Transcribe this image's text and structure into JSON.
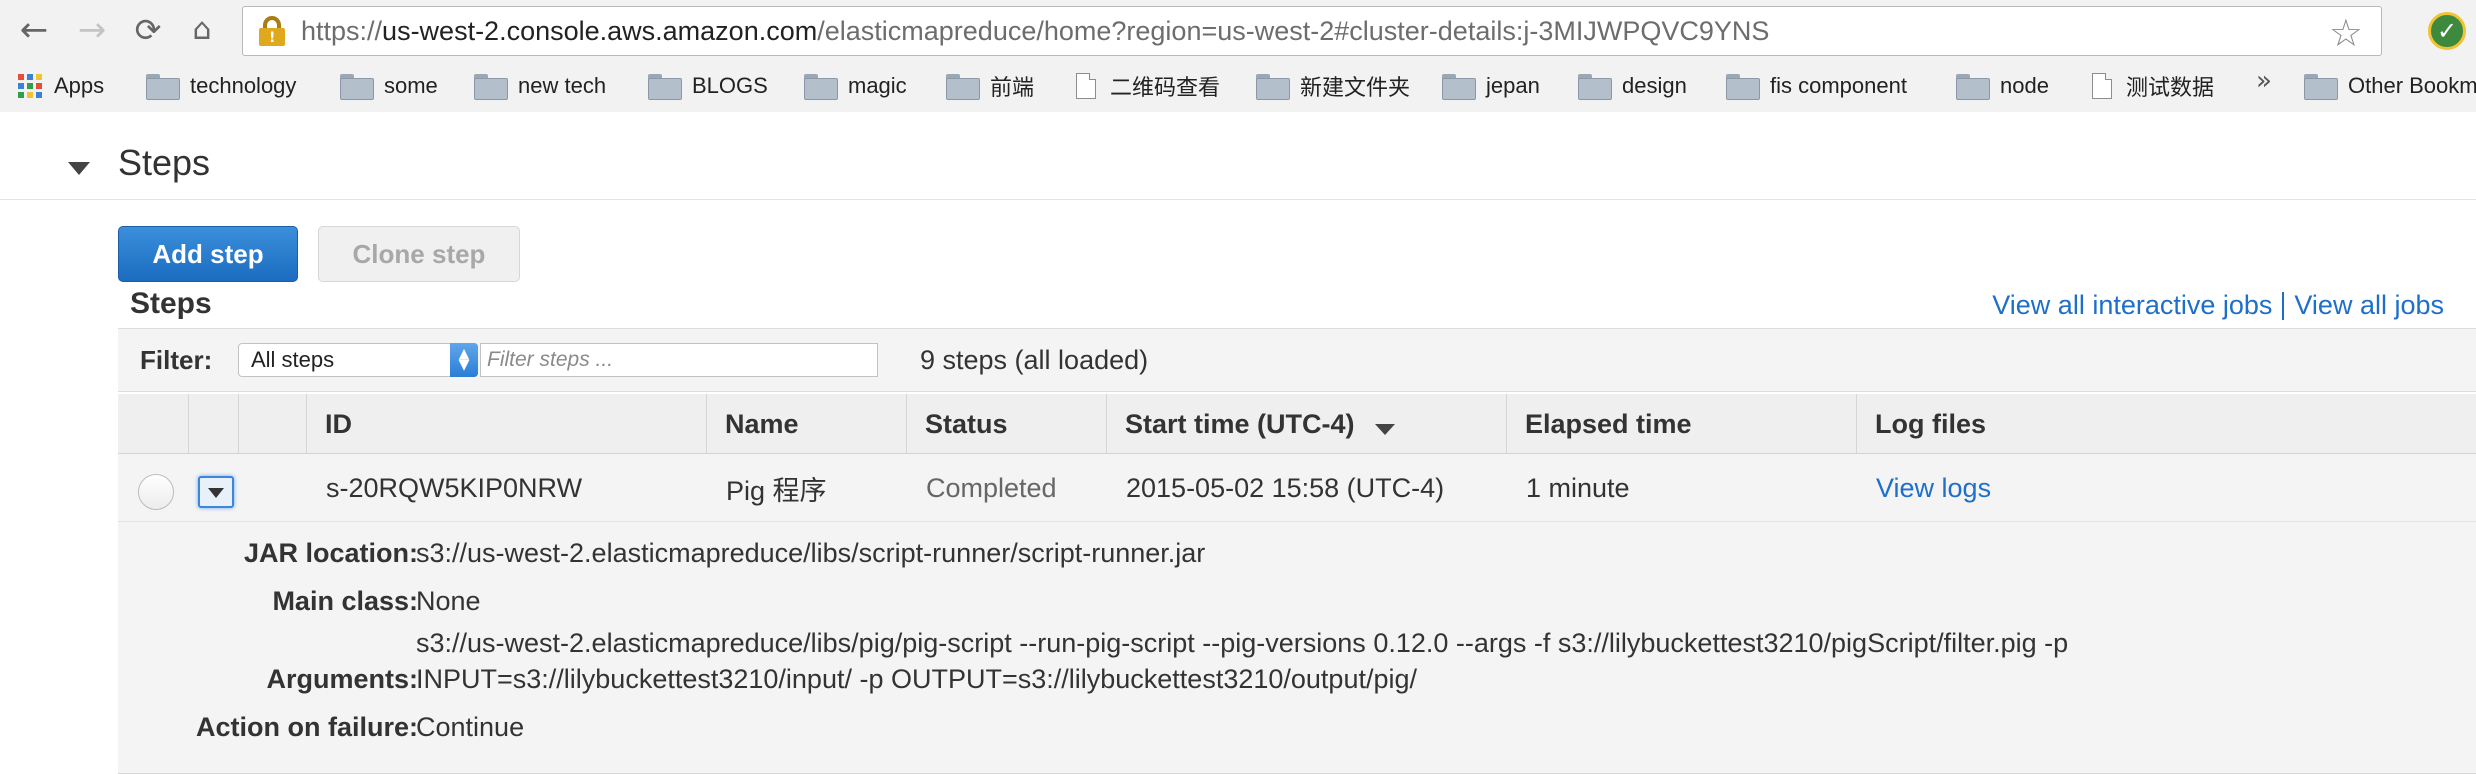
{
  "browser": {
    "url_scheme": "https://",
    "url_host": "us-west-2.console.aws.amazon.com",
    "url_path": "/elasticmapreduce/home?region=us-west-2#cluster-details:j-3MIJWPQVC9YNS",
    "icons": [
      "back-icon",
      "forward-icon",
      "reload-icon",
      "home-icon",
      "lock-warning-icon",
      "star-icon",
      "extension-icon"
    ]
  },
  "bookmarks": {
    "apps_label": "Apps",
    "items": [
      {
        "label": "technology",
        "icon": "folder-icon"
      },
      {
        "label": "some",
        "icon": "folder-icon"
      },
      {
        "label": "new tech",
        "icon": "folder-icon"
      },
      {
        "label": "BLOGS",
        "icon": "folder-icon"
      },
      {
        "label": "magic",
        "icon": "folder-icon"
      },
      {
        "label": "前端",
        "icon": "folder-icon"
      },
      {
        "label": "二维码查看",
        "icon": "page-icon"
      },
      {
        "label": "新建文件夹",
        "icon": "folder-icon"
      },
      {
        "label": "jepan",
        "icon": "folder-icon"
      },
      {
        "label": "design",
        "icon": "folder-icon"
      },
      {
        "label": "fis component",
        "icon": "folder-icon"
      },
      {
        "label": "node",
        "icon": "folder-icon"
      },
      {
        "label": "测试数据",
        "icon": "page-icon"
      }
    ],
    "more": "»",
    "other": "Other Bookm"
  },
  "section": {
    "title": "Steps",
    "add_step": "Add step",
    "clone_step": "Clone step",
    "subtitle": "Steps",
    "link_interactive": "View all interactive jobs",
    "link_all": "View all jobs"
  },
  "filter": {
    "label": "Filter:",
    "select_value": "All steps",
    "input_placeholder": "Filter steps ...",
    "count": "9 steps (all loaded)"
  },
  "table": {
    "columns": {
      "id": "ID",
      "name": "Name",
      "status": "Status",
      "start_time": "Start time (UTC-4)",
      "elapsed": "Elapsed time",
      "logs": "Log files"
    },
    "rows": [
      {
        "id": "s-20RQW5KIP0NRW",
        "name": "Pig 程序",
        "status": "Completed",
        "start_time": "2015-05-02 15:58 (UTC-4)",
        "elapsed": "1 minute",
        "logs": "View logs"
      }
    ]
  },
  "detail": {
    "jar_label": "JAR location:",
    "jar_value": "s3://us-west-2.elasticmapreduce/libs/script-runner/script-runner.jar",
    "main_label": "Main class:",
    "main_value": "None",
    "args_label": "Arguments:",
    "args_line1": "s3://us-west-2.elasticmapreduce/libs/pig/pig-script --run-pig-script --pig-versions 0.12.0 --args -f s3://lilybuckettest3210/pigScript/filter.pig -p",
    "args_line2": "INPUT=s3://lilybuckettest3210/input/ -p OUTPUT=s3://lilybuckettest3210/output/pig/",
    "failure_label": "Action on failure:",
    "failure_value": "Continue"
  },
  "colors": {
    "primary_button": "#1b6cc0",
    "link": "#1e6fc9",
    "chrome_bg": "#f2f2f2"
  }
}
